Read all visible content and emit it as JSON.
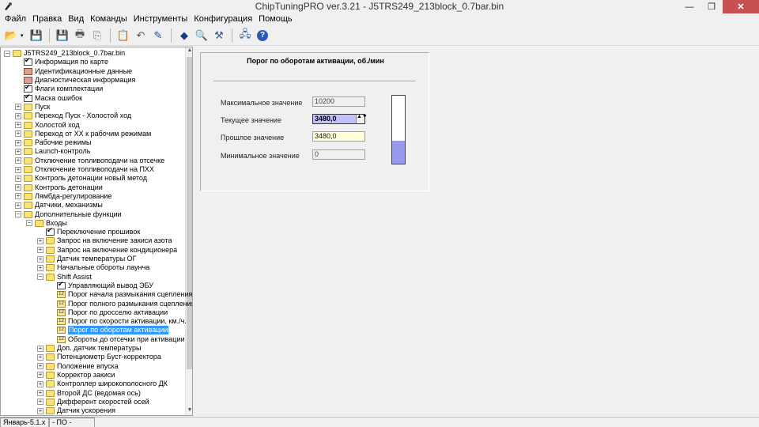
{
  "window": {
    "title": "ChipTuningPRO ver.3.21 - J5TRS249_213block_0.7bar.bin",
    "minimize": "—",
    "restore": "❐",
    "close": "✕"
  },
  "menu": [
    "Файл",
    "Правка",
    "Вид",
    "Команды",
    "Инструменты",
    "Конфигурация",
    "Помощь"
  ],
  "toolbar": {
    "buttons": [
      {
        "name": "open-icon",
        "glyph": "📂",
        "color": "#d9a400"
      },
      {
        "name": "save-icon",
        "glyph": "💾",
        "color": "#2a4aa0"
      },
      {
        "name": "save-as-icon",
        "glyph": "💾",
        "color": "#2a4aa0"
      },
      {
        "name": "print-icon",
        "glyph": "🖶",
        "color": "#555555"
      },
      {
        "name": "copy-icon",
        "glyph": "⎘",
        "color": "#777777"
      },
      {
        "name": "paste-icon",
        "glyph": "📋",
        "color": "#777777"
      },
      {
        "name": "undo-icon",
        "glyph": "↶",
        "color": "#555555"
      },
      {
        "name": "edit-icon",
        "glyph": "✎",
        "color": "#2a4aa0"
      },
      {
        "name": "diamond-icon",
        "glyph": "◆",
        "color": "#1a3a8a"
      },
      {
        "name": "search-icon",
        "glyph": "🔍",
        "color": "#2a6ab0"
      },
      {
        "name": "tools-icon",
        "glyph": "⚒",
        "color": "#3a5a8a"
      },
      {
        "name": "connect-icon",
        "glyph": "🖧",
        "color": "#2a6ab0"
      },
      {
        "name": "help-icon",
        "glyph": "?",
        "color": "#ffffff"
      }
    ],
    "dropdown_glyph": "▾"
  },
  "tree": {
    "expand_glyph": "+",
    "collapse_glyph": "−",
    "items": [
      {
        "label": "J5TRS249_213block_0.7bar.bin",
        "level": 0,
        "icon": "folder",
        "exp": "-"
      },
      {
        "label": "Информация по карте",
        "level": 1,
        "icon": "check",
        "exp": ""
      },
      {
        "label": "Идентификационные данные",
        "level": 1,
        "icon": "doc",
        "exp": ""
      },
      {
        "label": "Диагностическая информация",
        "level": 1,
        "icon": "doc",
        "exp": ""
      },
      {
        "label": "Флаги комплектации",
        "level": 1,
        "icon": "check",
        "exp": ""
      },
      {
        "label": "Маска ошибок",
        "level": 1,
        "icon": "check",
        "exp": ""
      },
      {
        "label": "Пуск",
        "level": 1,
        "icon": "folder",
        "exp": "+"
      },
      {
        "label": "Переход Пуск - Холостой ход",
        "level": 1,
        "icon": "folder",
        "exp": "+"
      },
      {
        "label": "Холостой ход",
        "level": 1,
        "icon": "folder",
        "exp": "+"
      },
      {
        "label": "Переход от ХХ к рабочим режимам",
        "level": 1,
        "icon": "folder",
        "exp": "+"
      },
      {
        "label": "Рабочие режимы",
        "level": 1,
        "icon": "folder",
        "exp": "+"
      },
      {
        "label": "Launch-контроль",
        "level": 1,
        "icon": "folder",
        "exp": "+"
      },
      {
        "label": "Отключение топливоподачи на отсечке",
        "level": 1,
        "icon": "folder",
        "exp": "+"
      },
      {
        "label": "Отключение топливоподачи на ПХХ",
        "level": 1,
        "icon": "folder",
        "exp": "+"
      },
      {
        "label": "Контроль детонации новый метод",
        "level": 1,
        "icon": "folder",
        "exp": "+"
      },
      {
        "label": "Контроль детонации",
        "level": 1,
        "icon": "folder",
        "exp": "+"
      },
      {
        "label": "Лямбда-регулирование",
        "level": 1,
        "icon": "folder",
        "exp": "+"
      },
      {
        "label": "Датчики, механизмы",
        "level": 1,
        "icon": "folder",
        "exp": "+"
      },
      {
        "label": "Дополнительные функции",
        "level": 1,
        "icon": "folder",
        "exp": "-"
      },
      {
        "label": "Входы",
        "level": 2,
        "icon": "folder",
        "exp": "-"
      },
      {
        "label": "Переключение прошивок",
        "level": 3,
        "icon": "check",
        "exp": ""
      },
      {
        "label": "Запрос на включение закиси азота",
        "level": 3,
        "icon": "folder",
        "exp": "+"
      },
      {
        "label": "Запрос на включение кондиционера",
        "level": 3,
        "icon": "folder",
        "exp": "+"
      },
      {
        "label": "Датчик температуры ОГ",
        "level": 3,
        "icon": "folder",
        "exp": "+"
      },
      {
        "label": "Начальные обороты лаунча",
        "level": 3,
        "icon": "folder",
        "exp": "+"
      },
      {
        "label": "Shift Assist",
        "level": 3,
        "icon": "folder",
        "exp": "-"
      },
      {
        "label": "Управляющий вывод ЭБУ",
        "level": 4,
        "icon": "check",
        "exp": ""
      },
      {
        "label": "Порог начала размыкания сцепления",
        "level": 4,
        "icon": "num",
        "exp": ""
      },
      {
        "label": "Порог полного размыкания сцепления",
        "level": 4,
        "icon": "num",
        "exp": ""
      },
      {
        "label": "Порог по дросселю активации",
        "level": 4,
        "icon": "num",
        "exp": ""
      },
      {
        "label": "Порог по скорости активации, км./ч.",
        "level": 4,
        "icon": "num",
        "exp": ""
      },
      {
        "label": "Порог по оборотам активации",
        "level": 4,
        "icon": "num",
        "exp": "",
        "selected": true
      },
      {
        "label": "Обороты до отсечки при активации",
        "level": 4,
        "icon": "num",
        "exp": ""
      },
      {
        "label": "Доп. датчик температуры",
        "level": 3,
        "icon": "folder",
        "exp": "+"
      },
      {
        "label": "Потенциометр Буст-корректора",
        "level": 3,
        "icon": "folder",
        "exp": "+"
      },
      {
        "label": "Положение впуска",
        "level": 3,
        "icon": "folder",
        "exp": "+"
      },
      {
        "label": "Корректор закиси",
        "level": 3,
        "icon": "folder",
        "exp": "+"
      },
      {
        "label": "Контроллер широкополосного ДК",
        "level": 3,
        "icon": "folder",
        "exp": "+"
      },
      {
        "label": "Второй ДС (ведомая ось)",
        "level": 3,
        "icon": "folder",
        "exp": "+"
      },
      {
        "label": "Дифферент скоростей осей",
        "level": 3,
        "icon": "folder",
        "exp": "+"
      },
      {
        "label": "Датчик ускорения",
        "level": 3,
        "icon": "folder",
        "exp": "+"
      }
    ]
  },
  "scrollbar": {
    "up": "▲",
    "down": "▼"
  },
  "param": {
    "title": "Порог по оборотам активации, об./мин",
    "max_label": "Максимальное значение",
    "max_value": "10200",
    "current_label": "Текущее значение",
    "current_value": "3480,0",
    "spin_glyph": "▲▼",
    "prev_label": "Прошлое значение",
    "prev_value": "3480,0",
    "min_label": "Минимальное значение",
    "min_value": "0",
    "level_fraction": 0.341
  },
  "status": {
    "left": "Январь-5.1.х",
    "middle": "- ПО -"
  }
}
